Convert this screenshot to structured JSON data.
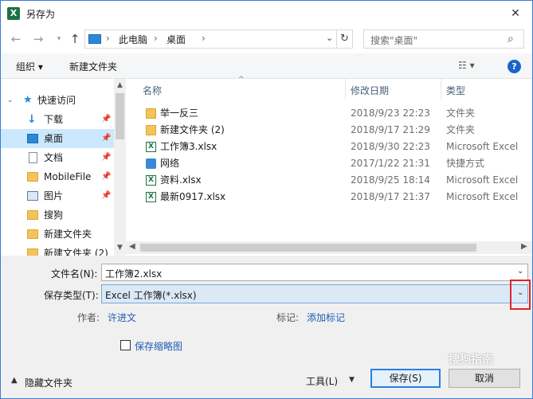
{
  "window": {
    "title": "另存为",
    "app_icon_letter": "X",
    "close_glyph": "✕"
  },
  "address": {
    "path": [
      "此电脑",
      "桌面"
    ],
    "separator": "›",
    "search_placeholder": "搜索\"桌面\""
  },
  "toolbar": {
    "organize_label": "组织 ▾",
    "new_folder_label": "新建文件夹",
    "help_label": "?"
  },
  "nav": {
    "items": [
      {
        "label": "快速访问",
        "icon": "star-icon"
      },
      {
        "label": "下载",
        "icon": "download-icon"
      },
      {
        "label": "桌面",
        "icon": "desktop-icon"
      },
      {
        "label": "文档",
        "icon": "document-icon"
      },
      {
        "label": "MobileFile",
        "icon": "folder-icon"
      },
      {
        "label": "图片",
        "icon": "picture-icon"
      },
      {
        "label": "搜狗",
        "icon": "folder-icon"
      },
      {
        "label": "新建文件夹",
        "icon": "folder-icon"
      },
      {
        "label": "新建文件夹 (2)",
        "icon": "folder-icon"
      }
    ]
  },
  "columns": {
    "name": "名称",
    "date": "修改日期",
    "type": "类型"
  },
  "files": [
    {
      "name": "举一反三",
      "date": "2018/9/23 22:23",
      "type": "文件夹",
      "icon": "folder-icon"
    },
    {
      "name": "新建文件夹 (2)",
      "date": "2018/9/17 21:29",
      "type": "文件夹",
      "icon": "folder-icon"
    },
    {
      "name": "工作簿3.xlsx",
      "date": "2018/9/30 22:23",
      "type": "Microsoft Excel",
      "icon": "excel-file-icon"
    },
    {
      "name": "网络",
      "date": "2017/1/22 21:31",
      "type": "快捷方式",
      "icon": "network-shortcut-icon"
    },
    {
      "name": "资料.xlsx",
      "date": "2018/9/25 18:14",
      "type": "Microsoft Excel",
      "icon": "excel-file-icon"
    },
    {
      "name": "最新0917.xlsx",
      "date": "2018/9/17 21:37",
      "type": "Microsoft Excel",
      "icon": "excel-file-icon"
    }
  ],
  "form": {
    "filename_label": "文件名(N):",
    "filename_value": "工作簿2.xlsx",
    "savetype_label": "保存类型(T):",
    "savetype_value": "Excel 工作簿(*.xlsx)",
    "author_label": "作者:",
    "author_value": "许进文",
    "tags_label": "标记:",
    "tags_value": "添加标记",
    "thumbnail_label": "保存缩略图"
  },
  "footer": {
    "hide_folders_label": "隐藏文件夹",
    "tools_label": "工具(L)",
    "save_label": "保存(S)",
    "cancel_label": "取消",
    "watermark": "搜狗指南"
  }
}
